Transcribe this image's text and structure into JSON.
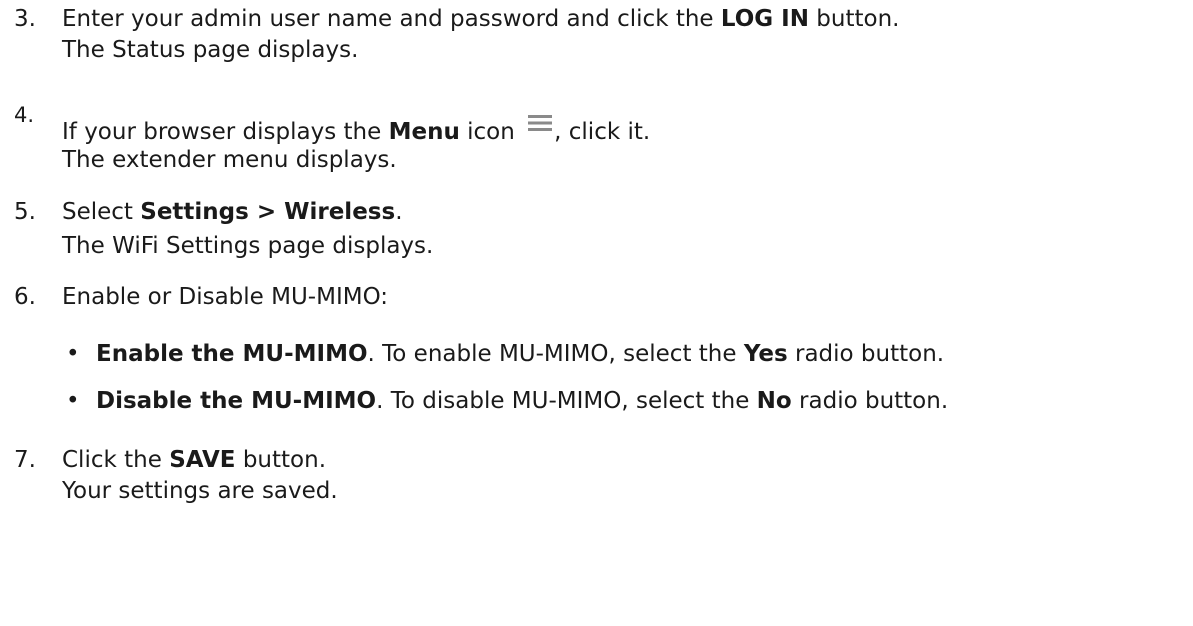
{
  "steps": [
    {
      "number": "3.",
      "line1": {
        "pre": "Enter your admin user name and password and click the ",
        "bold": "LOG IN",
        "post": " button."
      },
      "line2": "The Status page displays."
    },
    {
      "number": "4.",
      "line1": {
        "pre": "If your browser displays the ",
        "bold": "Menu",
        "mid": " icon ",
        "icon": "hamburger-menu-icon",
        "post": ", click it."
      },
      "line2": "The extender menu displays."
    },
    {
      "number": "5.",
      "line1": {
        "pre": "Select ",
        "bold": "Settings > Wireless",
        "post": "."
      },
      "line2": "The WiFi Settings page displays."
    },
    {
      "number": "6.",
      "line1": {
        "pre": "Enable or Disable MU-MIMO:"
      },
      "bullets": [
        {
          "bold": "Enable the MU-MIMO",
          "mid": ". To enable MU-MIMO, select the ",
          "bold2": "Yes",
          "post": " radio button."
        },
        {
          "bold": "Disable the MU-MIMO",
          "mid": ". To disable MU-MIMO, select the ",
          "bold2": "No",
          "post": " radio button."
        }
      ]
    },
    {
      "number": "7.",
      "line1": {
        "pre": "Click the ",
        "bold": "SAVE",
        "post": " button."
      },
      "line2": "Your settings are saved."
    }
  ],
  "icon_color": "#8a8a8a"
}
